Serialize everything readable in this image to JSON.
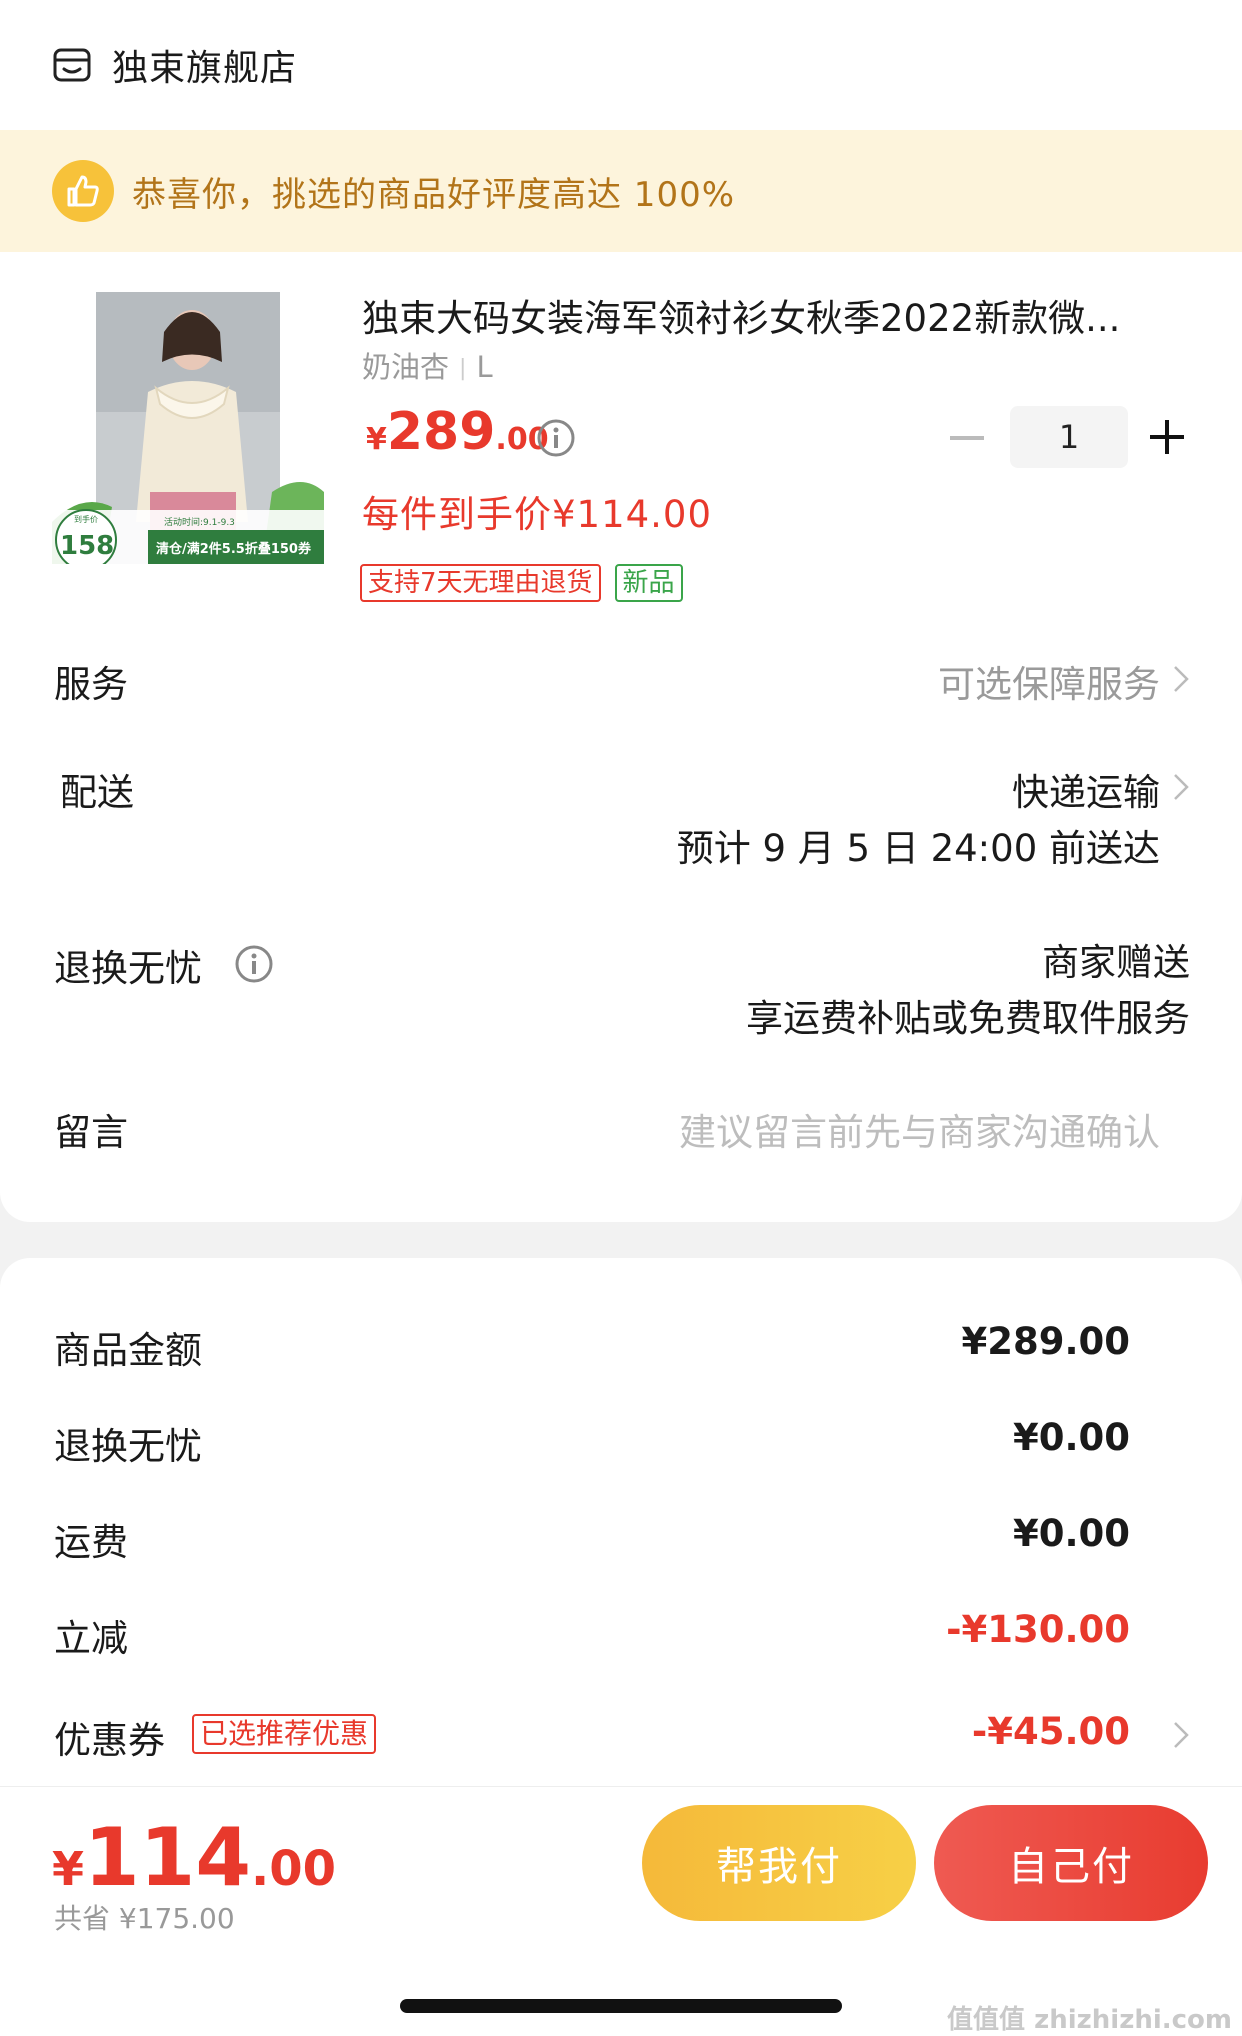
{
  "store": {
    "name": "独束旗舰店",
    "icon": "store-icon"
  },
  "praise": {
    "text": "恭喜你，挑选的商品好评度高达 100%",
    "icon": "thumbs-up-icon"
  },
  "product": {
    "title": "独束大码女装海军领衬衫女秋季2022新款微...",
    "spec_color": "奶油杏",
    "spec_size": "L",
    "price_currency": "¥",
    "price_integer": "289",
    "price_decimal": ".00",
    "final_price": "每件到手价¥114.00",
    "quantity": "1",
    "tags": [
      "支持7天无理由退货",
      "新品"
    ],
    "image": {
      "promo_price_label": "到手价",
      "promo_price": "158",
      "activity_time": "活动时间:9.1-9.3",
      "promo_text": "清仓/满2件5.5折叠150券"
    }
  },
  "rows": {
    "service_label": "服务",
    "service_value": "可选保障服务",
    "delivery_label": "配送",
    "delivery_method": "快递运输",
    "delivery_eta": "预计 9 月 5 日 24:00 前送达",
    "return_label": "退换无忧",
    "return_value1": "商家赠送",
    "return_value2": "享运费补贴或免费取件服务",
    "message_label": "留言",
    "message_placeholder": "建议留言前先与商家沟通确认"
  },
  "summary": {
    "goods_amount_label": "商品金额",
    "goods_amount": "¥289.00",
    "return_label": "退换无忧",
    "return_amount": "¥0.00",
    "shipping_label": "运费",
    "shipping_amount": "¥0.00",
    "discount_label": "立减",
    "discount_amount": "-¥130.00",
    "coupon_label": "优惠券",
    "coupon_tag": "已选推荐优惠",
    "coupon_amount": "-¥45.00"
  },
  "bottom": {
    "total_currency": "¥",
    "total_integer": "114",
    "total_decimal": ".00",
    "saved": "共省 ¥175.00",
    "help_pay": "帮我付",
    "self_pay": "自己付"
  },
  "watermark": "值值值 zhizhizhi.com",
  "colors": {
    "accent": "#e8392c",
    "success": "#3aa54a",
    "banner_bg": "#fdf4dc",
    "banner_text": "#b27419"
  }
}
